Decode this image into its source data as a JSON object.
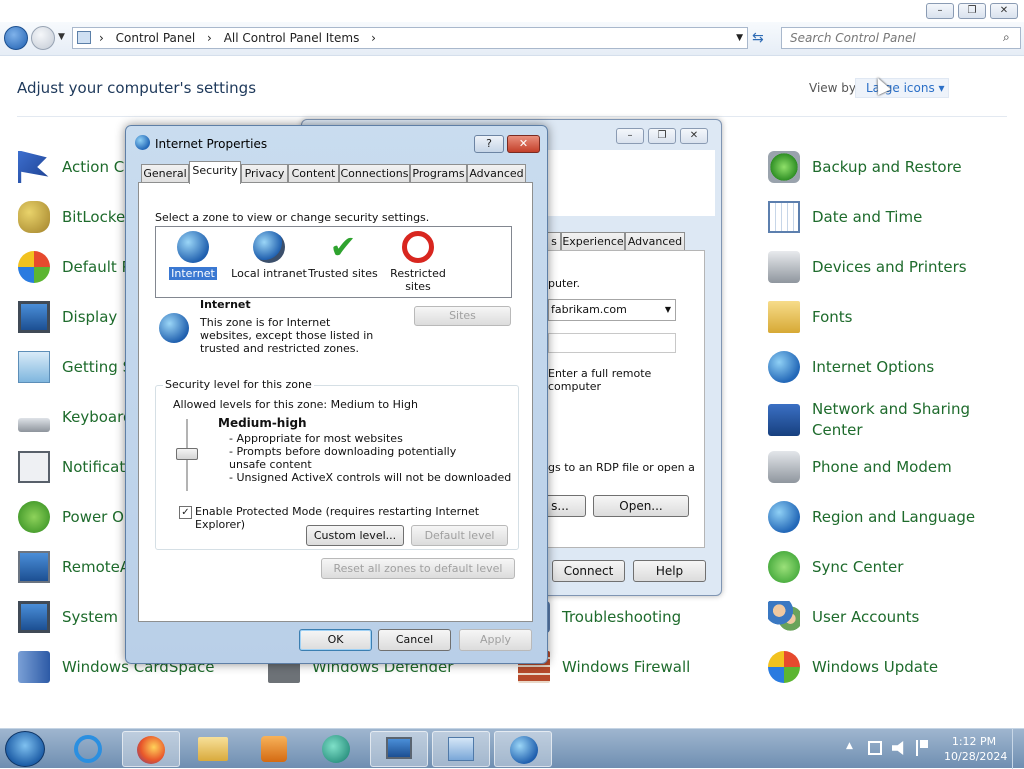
{
  "window": {
    "min": "–",
    "max": "❐",
    "close": "✕"
  },
  "nav": {
    "breadcrumbs": [
      "Control Panel",
      "All Control Panel Items"
    ],
    "search_placeholder": "Search Control Panel"
  },
  "header": {
    "title": "Adjust your computer's settings",
    "view_by_label": "View by:",
    "view_by_value": "Large icons ▾"
  },
  "items_col1": [
    "Action Center",
    "BitLocker Drive Encryption",
    "Default Programs",
    "Display",
    "Getting Started",
    "Keyboard",
    "Notification Area Icons",
    "Power Options",
    "RemoteApp and Desktop Connections",
    "System",
    "Windows CardSpace"
  ],
  "items_col2": [
    "Troubleshooting",
    "Windows Defender"
  ],
  "items_col3": [
    "Windows Firewall"
  ],
  "items_col4": [
    "Backup and Restore",
    "Date and Time",
    "Devices and Printers",
    "Fonts",
    "Internet Options",
    "Network and Sharing Center",
    "Phone and Modem",
    "Region and Language",
    "Sync Center",
    "User Accounts",
    "Windows Update"
  ],
  "bg_dialog": {
    "tabs": [
      "s",
      "Experience",
      "Advanced"
    ],
    "text1": "puter.",
    "combo": "fabrikam.com",
    "text2": "Enter a full remote computer",
    "text3": "gs to an RDP file or open a",
    "btn_save": "s...",
    "btn_open": "Open...",
    "btn_connect": "Connect",
    "btn_help": "Help"
  },
  "dialog": {
    "title": "Internet Properties",
    "help": "?",
    "close": "✕",
    "tabs": [
      "General",
      "Security",
      "Privacy",
      "Content",
      "Connections",
      "Programs",
      "Advanced"
    ],
    "zone_prompt": "Select a zone to view or change security settings.",
    "zones": [
      "Internet",
      "Local intranet",
      "Trusted sites",
      "Restricted sites"
    ],
    "zone_name": "Internet",
    "zone_desc": "This zone is for Internet websites, except those listed in trusted and restricted zones.",
    "sites_btn": "Sites",
    "group_label": "Security level for this zone",
    "allowed": "Allowed levels for this zone: Medium to High",
    "level_name": "Medium-high",
    "level_points": [
      "- Appropriate for most websites",
      "- Prompts before downloading potentially unsafe content",
      "- Unsigned ActiveX controls will not be downloaded"
    ],
    "protected_mode": "Enable Protected Mode (requires restarting Internet Explorer)",
    "custom_btn": "Custom level...",
    "default_btn": "Default level",
    "reset_btn": "Reset all zones to default level",
    "ok": "OK",
    "cancel": "Cancel",
    "apply": "Apply"
  },
  "taskbar": {
    "time": "1:12 PM",
    "date": "10/28/2024",
    "tray_arrow": "▲"
  }
}
